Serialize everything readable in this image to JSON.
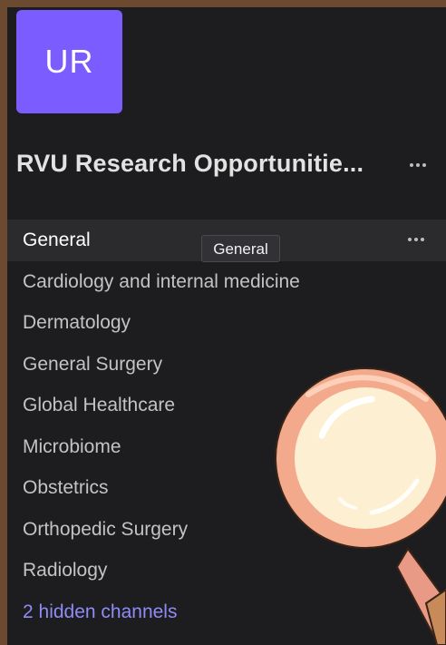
{
  "team": {
    "avatar_initials": "UR",
    "avatar_color": "#7b5cff",
    "name": "RVU Research Opportunitie...",
    "more_icon": "more-horizontal-icon"
  },
  "channels": [
    {
      "label": "General",
      "selected": true
    },
    {
      "label": "Cardiology and internal medicine"
    },
    {
      "label": "Dermatology"
    },
    {
      "label": "General Surgery"
    },
    {
      "label": "Global Healthcare"
    },
    {
      "label": "Microbiome"
    },
    {
      "label": "Obstetrics"
    },
    {
      "label": "Orthopedic Surgery"
    },
    {
      "label": "Radiology"
    }
  ],
  "hidden_channels_link": "2 hidden channels",
  "tooltip": "General",
  "overlay_icon": "magnifying-glass-icon",
  "colors": {
    "panel_bg": "#1d1d1f",
    "selected_bg": "#2b2b2d",
    "link": "#8f8cf5",
    "magnifier_rim": "#f3a98c",
    "magnifier_lens": "#fdf0d2"
  }
}
